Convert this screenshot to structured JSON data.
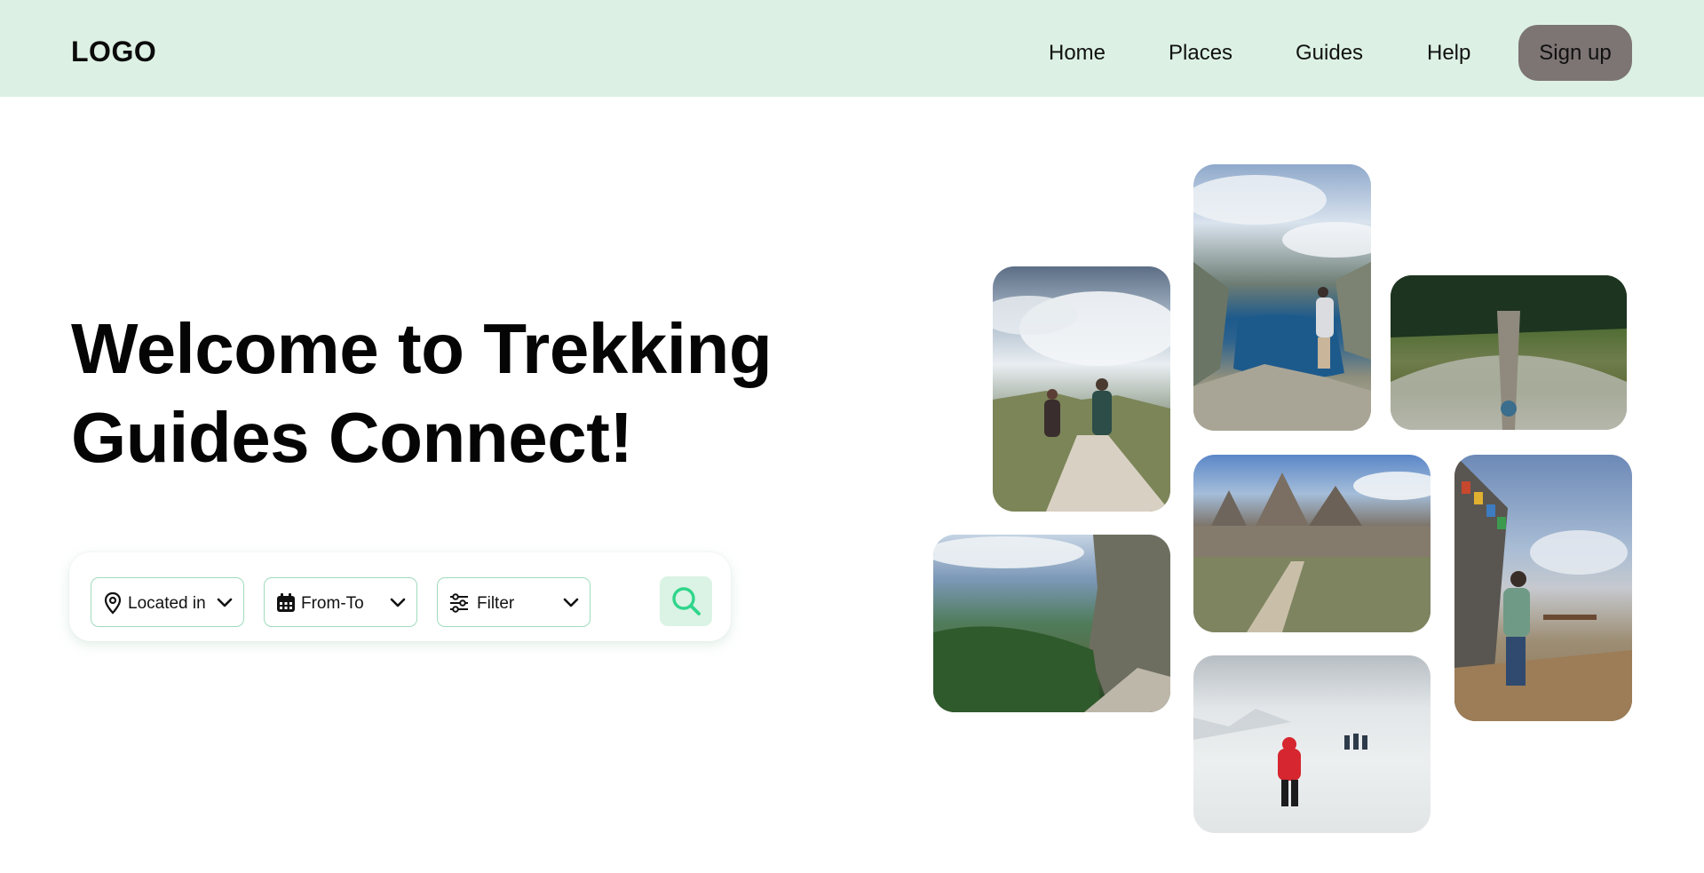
{
  "header": {
    "logo": "LOGO",
    "nav": [
      {
        "label": "Home"
      },
      {
        "label": "Places"
      },
      {
        "label": "Guides"
      },
      {
        "label": "Help"
      }
    ],
    "signup_label": "Sign up"
  },
  "hero": {
    "title_line1": "Welcome to Trekking",
    "title_line2": "Guides Connect!"
  },
  "search": {
    "location_label": "Located in",
    "date_label": "From-To",
    "filter_label": "Filter"
  },
  "colors": {
    "header_bg": "#dcf1e3",
    "accent": "#2fd58a",
    "field_border": "#9fdbbd",
    "signup_bg": "#7d7474"
  },
  "icons": [
    "map-pin-icon",
    "calendar-icon",
    "sliders-icon",
    "chevron-down-icon",
    "search-icon"
  ]
}
